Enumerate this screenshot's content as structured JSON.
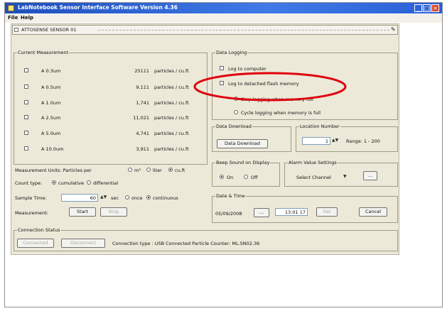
{
  "window": {
    "title": "LabNotebook Sensor Interface Software Version 4.36"
  },
  "menu": [
    "File",
    "Help"
  ],
  "toolbar": {
    "label": "ATTOSENSE  SENSOR 01"
  },
  "current_measurement": {
    "title": "Current Measurement",
    "rows": [
      {
        "channel": "A 0.3um",
        "value": "25111",
        "unit": "particles / cu.ft"
      },
      {
        "channel": "A 0.5um",
        "value": "9,111",
        "unit": "particles / cu.ft"
      },
      {
        "channel": "A 1.0um",
        "value": "1,741",
        "unit": "particles / cu.ft"
      },
      {
        "channel": "A 2.5um",
        "value": "11,021",
        "unit": "particles / cu.ft"
      },
      {
        "channel": "A 5.0um",
        "value": "4,741",
        "unit": "particles / cu.ft"
      },
      {
        "channel": "A 10.0um",
        "value": "3,911",
        "unit": "particles / cu.ft"
      }
    ],
    "units_label": "Measurement Units: Particles per",
    "units_opts": [
      "m³",
      "liter",
      "cu.ft"
    ],
    "count_type_label": "Count type:",
    "count_type_opts": [
      "cumulative",
      "differential"
    ],
    "sample_time_label": "Sample Time:",
    "sample_time_value": "60",
    "sample_time_unit": "sec",
    "sample_mode_opts": [
      "once",
      "continuous"
    ],
    "measurement_label": "Measurement:",
    "start": "Start",
    "stop": "Stop"
  },
  "data_logging": {
    "title": "Data Logging",
    "opt1": "Log to computer",
    "opt2": "Log to detached flash memory",
    "sub1": "Stop logging when memory full",
    "sub2": "Cycle logging when memory is full"
  },
  "data_download": {
    "title": "Data Download",
    "button": "Data Download"
  },
  "location_number": {
    "title": "Location Number",
    "value": "1",
    "range": "Range: 1 - 200"
  },
  "beep": {
    "title": "Beep Sound on Display",
    "opts": [
      "On",
      "Off"
    ]
  },
  "alarm": {
    "title": "Alarm Value Settings",
    "select": "Select Channel",
    "button": "..."
  },
  "date_time": {
    "title": "Date & Time",
    "date": "05/09/2008",
    "time": "13:01 17",
    "set_label": "Set",
    "cancel": "Cancel"
  },
  "connection": {
    "title": "Connection Status",
    "connect": "Connected",
    "disconnect": "Disconnect",
    "status": "Connection type : USB    Connected Particle Counter: ML.SN02.36"
  },
  "annotation": {
    "color": "#e0000c"
  }
}
